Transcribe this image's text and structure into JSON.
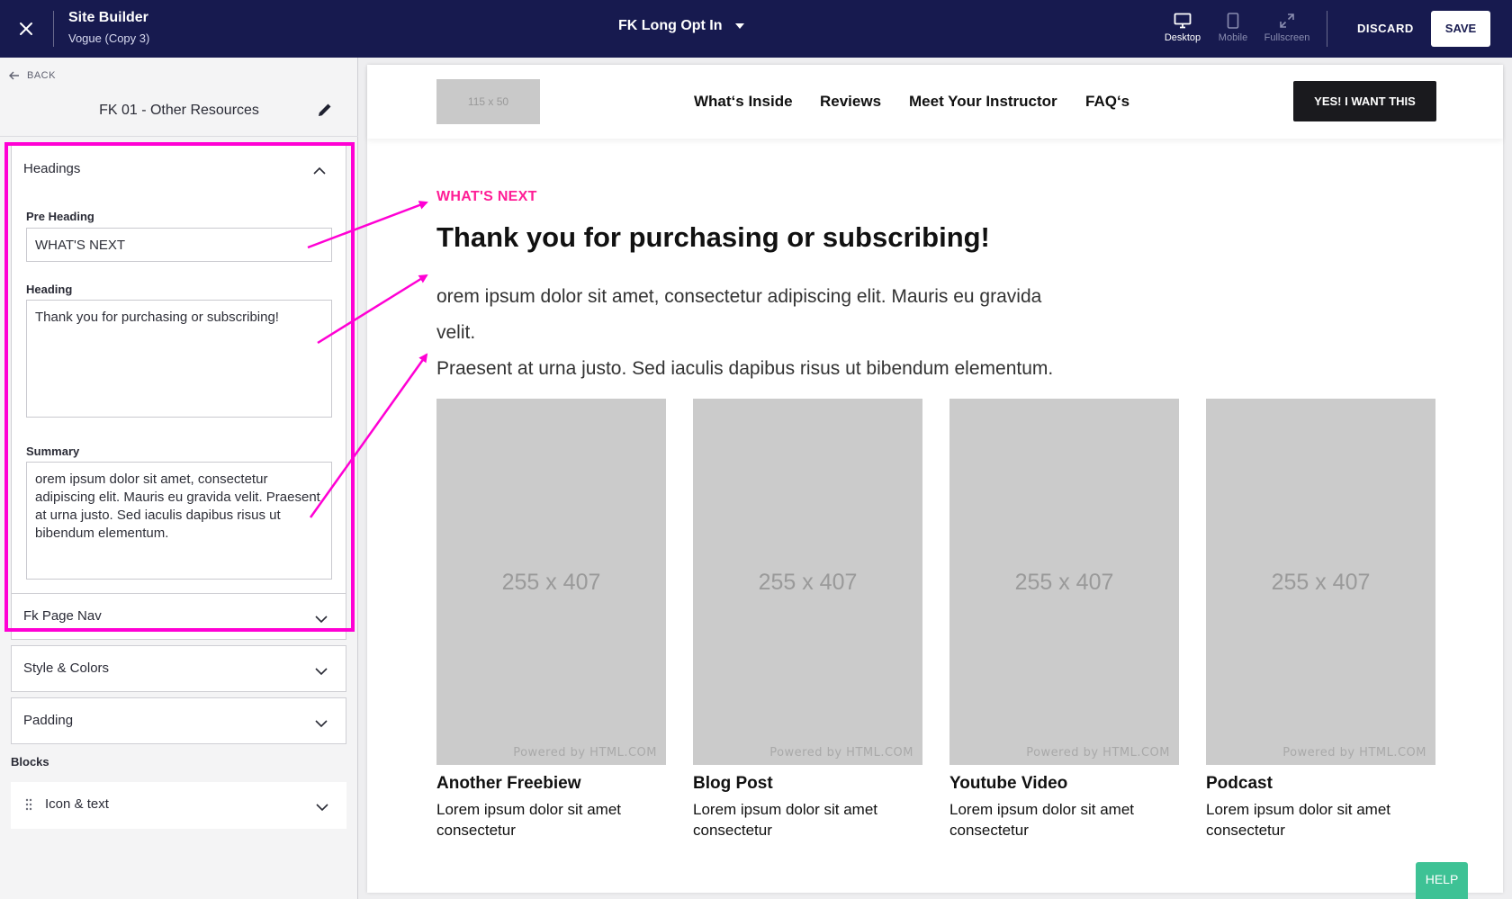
{
  "topbar": {
    "app_title": "Site Builder",
    "app_subtitle": "Vogue (Copy 3)",
    "page_name": "FK Long Opt In",
    "views": [
      {
        "label": "Desktop",
        "icon": "desktop-icon",
        "active": true
      },
      {
        "label": "Mobile",
        "icon": "mobile-icon",
        "active": false
      },
      {
        "label": "Fullscreen",
        "icon": "fullscreen-icon",
        "active": false
      }
    ],
    "discard_label": "DISCARD",
    "save_label": "SAVE",
    "bg_color": "#171a4f"
  },
  "sidebar": {
    "back_label": "BACK",
    "section_title": "FK 01 - Other Resources",
    "headings_panel": {
      "title": "Headings",
      "pre_heading_label": "Pre Heading",
      "pre_heading_value": "WHAT'S NEXT",
      "heading_label": "Heading",
      "heading_value": "Thank you for purchasing or subscribing!",
      "summary_label": "Summary",
      "summary_value": "orem ipsum dolor sit amet, consectetur adipiscing elit. Mauris eu gravida velit. Praesent at urna justo. Sed iaculis dapibus risus ut bibendum elementum."
    },
    "collapsed_panels": [
      "Fk Page Nav",
      "Style & Colors",
      "Padding"
    ],
    "blocks_label": "Blocks",
    "blocks": [
      "Icon & text"
    ],
    "highlight_color": "#ff00d4"
  },
  "site": {
    "logo_placeholder": "115 x 50",
    "nav": [
      "What‘s Inside",
      "Reviews",
      "Meet Your Instructor",
      "FAQ‘s"
    ],
    "cta_label": "YES! I WANT THIS",
    "pre_heading": "WHAT'S NEXT",
    "heading": "Thank you for purchasing or subscribing!",
    "summary_line1": "orem ipsum dolor sit amet, consectetur adipiscing elit. Mauris eu gravida velit.",
    "summary_line2": "Praesent at urna justo. Sed iaculis dapibus risus ut bibendum elementum.",
    "accent_color": "#ff1d96",
    "cards": [
      {
        "image_placeholder": "255 x 407",
        "powered": "Powered by HTML.COM",
        "title": "Another Freebiew",
        "text": "Lorem ipsum dolor sit amet consectetur"
      },
      {
        "image_placeholder": "255 x 407",
        "powered": "Powered by HTML.COM",
        "title": "Blog Post",
        "text": "Lorem ipsum dolor sit amet consectetur"
      },
      {
        "image_placeholder": "255 x 407",
        "powered": "Powered by HTML.COM",
        "title": "Youtube Video",
        "text": "Lorem ipsum dolor sit amet consectetur"
      },
      {
        "image_placeholder": "255 x 407",
        "powered": "Powered by HTML.COM",
        "title": "Podcast",
        "text": "Lorem ipsum dolor sit amet consectetur"
      }
    ]
  },
  "help_label": "HELP",
  "help_color": "#3ec295"
}
